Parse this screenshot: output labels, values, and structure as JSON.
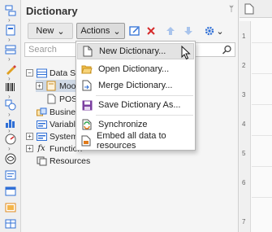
{
  "panel": {
    "title": "Dictionary"
  },
  "toolbar": {
    "new_label": "New",
    "actions_label": "Actions",
    "icons": [
      "edit-dictionary-icon",
      "delete-icon",
      "move-up-icon",
      "move-down-icon",
      "settings-icon"
    ]
  },
  "search": {
    "placeholder": "Search"
  },
  "tree": {
    "data_sources": "Data Sou",
    "moosa": "Moosa",
    "posf": "POSF",
    "business": "Business",
    "variables": "Variables",
    "system": "System V",
    "functions": "Function",
    "resources": "Resources"
  },
  "menu": {
    "items": [
      {
        "label": "New Dictionary...",
        "icon": "new-document-icon"
      },
      {
        "label": "Open Dictionary...",
        "icon": "open-folder-icon"
      },
      {
        "label": "Merge Dictionary...",
        "icon": "merge-document-icon"
      },
      {
        "label": "Save Dictionary As...",
        "icon": "save-icon"
      },
      {
        "label": "Synchronize",
        "icon": "synchronize-icon"
      },
      {
        "label": "Embed all data to resources",
        "icon": "embed-resources-icon"
      }
    ]
  },
  "ruler": {
    "numbers": [
      "1",
      "2",
      "3",
      "4",
      "5",
      "6",
      "7"
    ]
  },
  "colors": {
    "accent": "#2f6fd6",
    "delete": "#d62b2b",
    "disabled_arrow": "#a9c4ec",
    "save": "#7b3fa0"
  }
}
